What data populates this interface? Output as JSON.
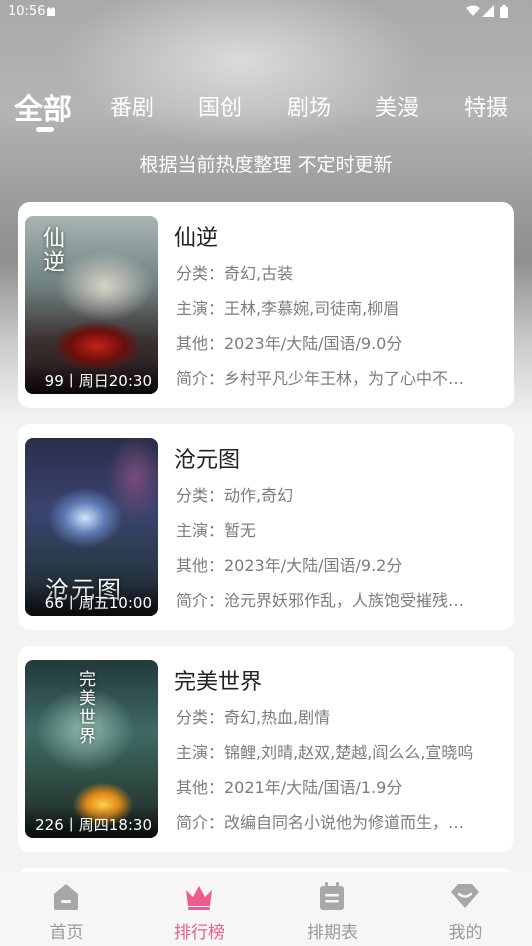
{
  "status_bar": {
    "time": "10:56"
  },
  "tabs": [
    "全部",
    "番剧",
    "国创",
    "剧场",
    "美漫",
    "特摄"
  ],
  "subtitle": "根据当前热度整理 不定时更新",
  "items": [
    {
      "title": "仙逆",
      "poster_text": "仙逆",
      "episode": "99丨周日20:30",
      "genre": "分类：奇幻,古装",
      "cast": "主演：王林,李慕婉,司徒南,柳眉",
      "other": "其他：2023年/大陆/国语/9.0分",
      "intro": "简介：乡村平凡少年王林，为了心中不…"
    },
    {
      "title": "沧元图",
      "poster_text": "沧元图",
      "episode": "66丨周五10:00",
      "genre": "分类：动作,奇幻",
      "cast": "主演：暂无",
      "other": "其他：2023年/大陆/国语/9.2分",
      "intro": "简介：沧元界妖邪作乱，人族饱受摧残…"
    },
    {
      "title": "完美世界",
      "poster_text": "完美世界",
      "episode": "226丨周四18:30",
      "genre": "分类：奇幻,热血,剧情",
      "cast": "主演：锦鲤,刘晴,赵双,楚越,阎么么,宣晓呜",
      "other": "其他：2021年/大陆/国语/1.9分",
      "intro": "简介：改编自同名小说他为修道而生，…"
    }
  ],
  "nav": [
    {
      "label": "首页",
      "icon": "home-icon"
    },
    {
      "label": "排行榜",
      "icon": "crown-icon",
      "active": true
    },
    {
      "label": "排期表",
      "icon": "calendar-icon"
    },
    {
      "label": "我的",
      "icon": "profile-icon"
    }
  ],
  "colors": {
    "accent": "#ef5b8c",
    "nav_inactive": "#9a9a9a"
  }
}
